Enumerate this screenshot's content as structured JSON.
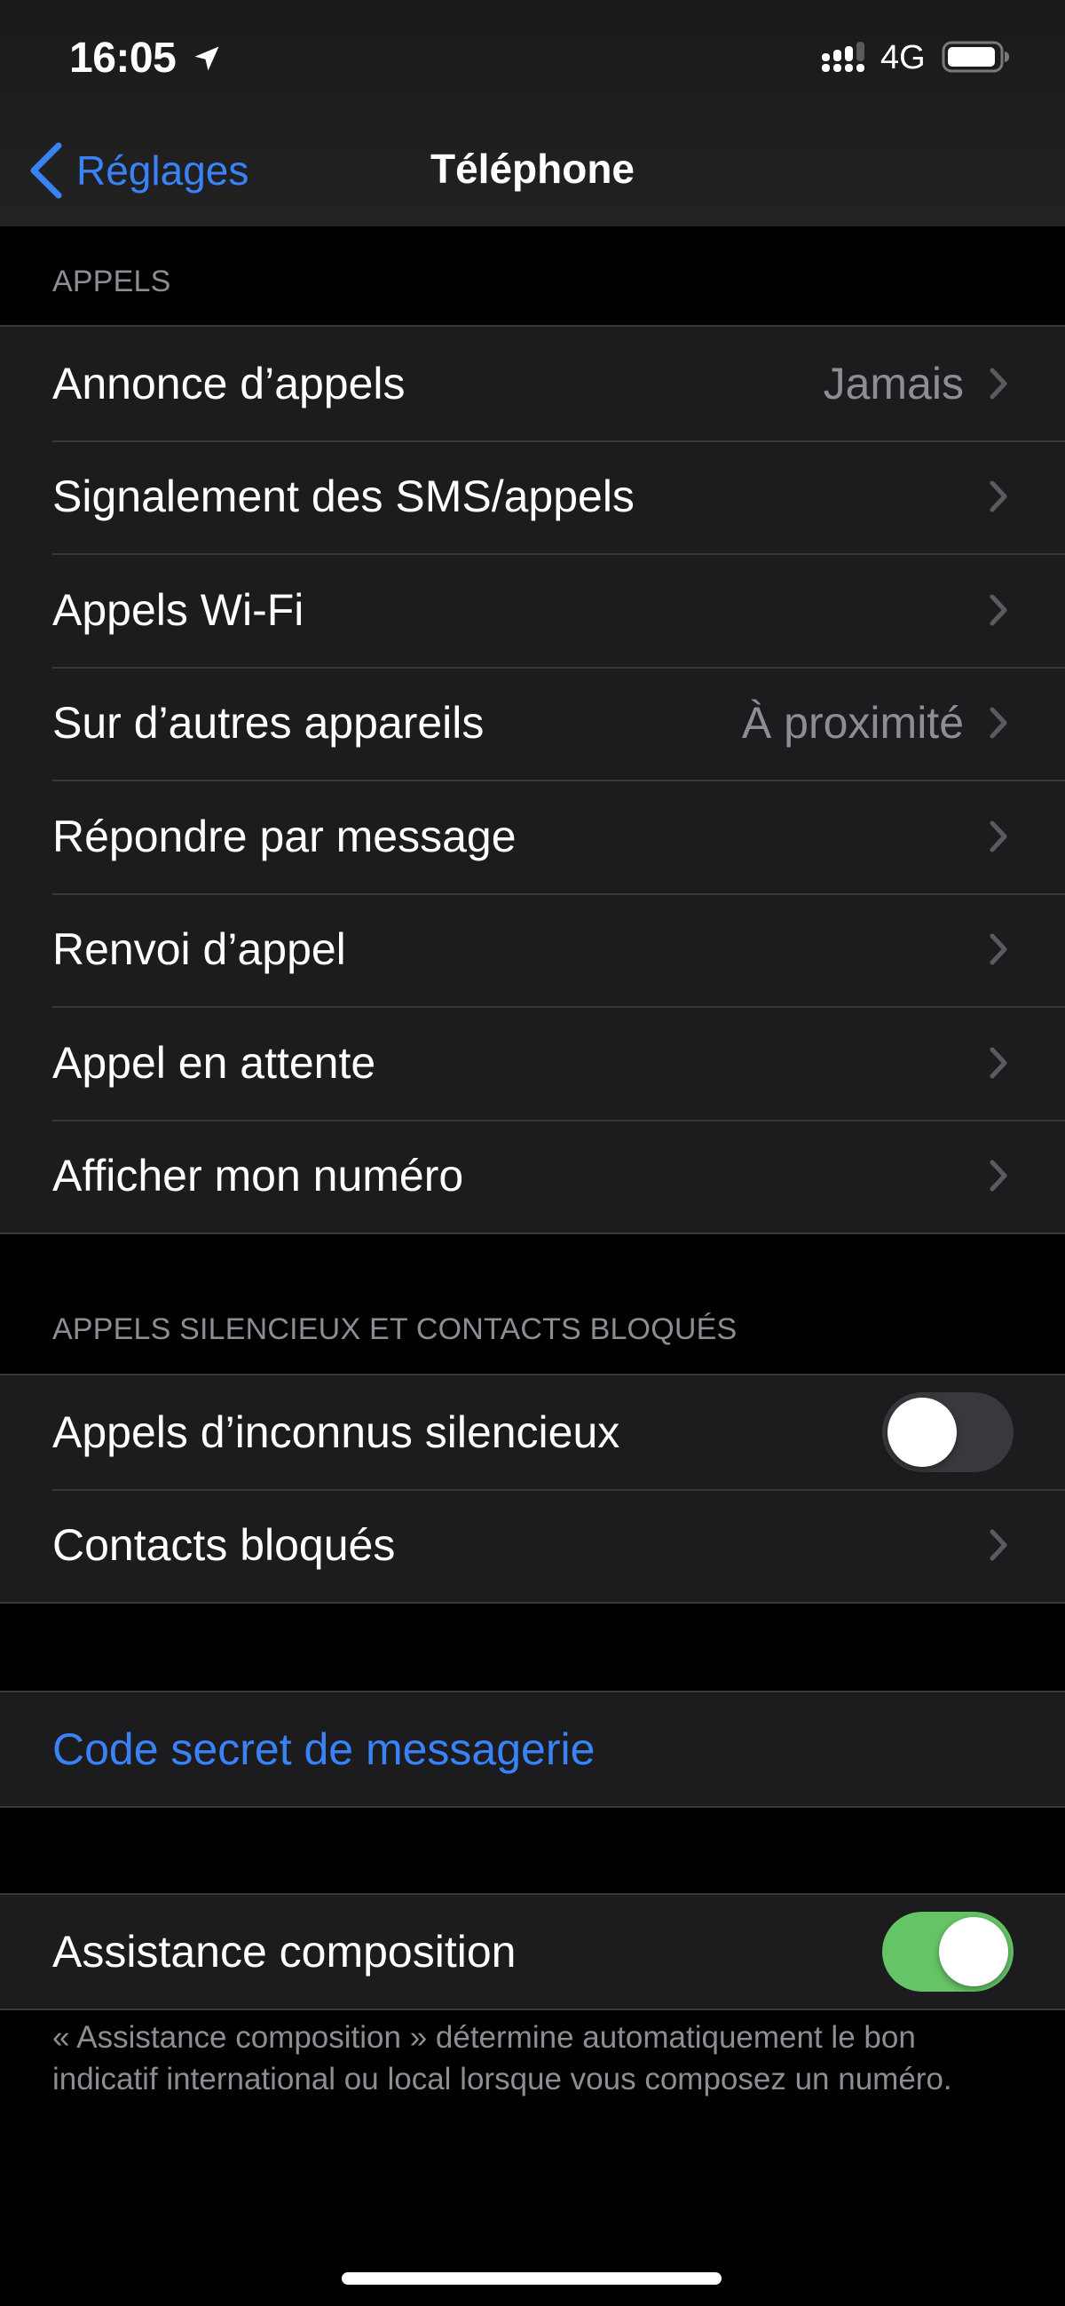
{
  "status_bar": {
    "time": "16:05",
    "location_icon": "location-arrow-icon",
    "signal_icon": "cellular-signal-icon",
    "network": "4G",
    "battery_icon": "battery-icon"
  },
  "nav": {
    "back_label": "Réglages",
    "back_icon": "chevron-left-icon",
    "title": "Téléphone"
  },
  "sections": [
    {
      "header": "APPELS",
      "rows": [
        {
          "label": "Annonce d’appels",
          "value": "Jamais",
          "accessory": "chevron"
        },
        {
          "label": "Signalement des SMS/appels",
          "value": "",
          "accessory": "chevron"
        },
        {
          "label": "Appels Wi-Fi",
          "value": "",
          "accessory": "chevron"
        },
        {
          "label": "Sur d’autres appareils",
          "value": "À proximité",
          "accessory": "chevron"
        },
        {
          "label": "Répondre par message",
          "value": "",
          "accessory": "chevron"
        },
        {
          "label": "Renvoi d’appel",
          "value": "",
          "accessory": "chevron"
        },
        {
          "label": "Appel en attente",
          "value": "",
          "accessory": "chevron"
        },
        {
          "label": "Afficher mon numéro",
          "value": "",
          "accessory": "chevron"
        }
      ]
    },
    {
      "header": "APPELS SILENCIEUX ET CONTACTS BLOQUÉS",
      "rows": [
        {
          "label": "Appels d’inconnus silencieux",
          "accessory": "toggle",
          "on": false
        },
        {
          "label": "Contacts bloqués",
          "value": "",
          "accessory": "chevron"
        }
      ]
    },
    {
      "header": "",
      "rows": [
        {
          "label": "Code secret de messagerie",
          "accessory": "none",
          "style": "link"
        }
      ]
    },
    {
      "header": "",
      "rows": [
        {
          "label": "Assistance composition",
          "accessory": "toggle",
          "on": true
        }
      ],
      "footer": "« Assistance composition » détermine automatiquement le bon indicatif international ou local lorsque vous composez un numéro."
    }
  ],
  "colors": {
    "accent": "#3a82f7",
    "toggle_on": "#65c466",
    "toggle_off": "#39393d",
    "secondary_text": "#8d8d93",
    "group_bg": "#1c1c1e"
  }
}
